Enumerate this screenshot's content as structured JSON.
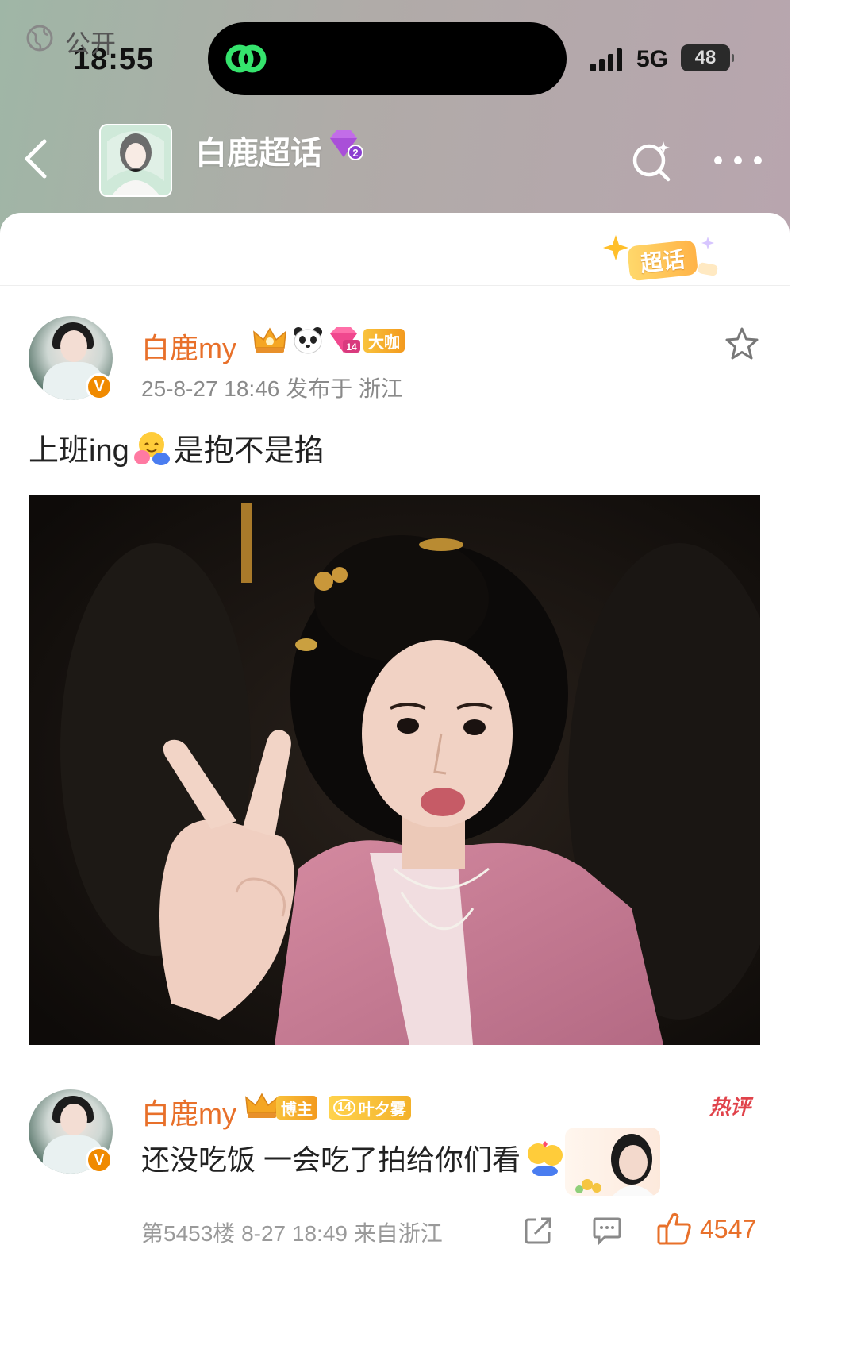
{
  "status_bar": {
    "time": "18:55",
    "network": "5G",
    "battery": "48"
  },
  "header": {
    "topic_title": "白鹿超话",
    "topic_badge_level": "2"
  },
  "post": {
    "visibility": "公开",
    "supertopic_tag": "超话",
    "author_name": "白鹿my",
    "author_tag": "大咖",
    "gem_level": "14",
    "verified": "V",
    "meta": "25-8-27 18:46  发布于 浙江",
    "text_before": "上班ing",
    "text_after": "是抱不是掐"
  },
  "comment": {
    "author_name": "白鹿my",
    "role_tag": "博主",
    "fan_level": "14",
    "fan_title": "叶夕雾",
    "hot_label": "热评",
    "text": "还没吃饭 一会吃了拍给你们看",
    "footer": "第5453楼  8-27 18:49  来自浙江",
    "likes": "4547"
  },
  "colors": {
    "accent_orange": "#e8702a",
    "hot_red": "#e0424a",
    "meta_gray": "#8a8a8a"
  }
}
